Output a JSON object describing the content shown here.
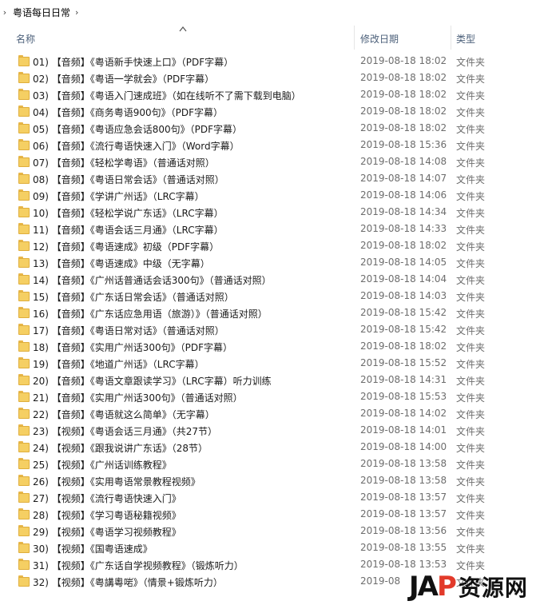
{
  "breadcrumb": {
    "chevron": "›",
    "path": "粤语每日日常",
    "separator": "›"
  },
  "header": {
    "name": "名称",
    "date": "修改日期",
    "type": "类型",
    "sort_icon": "chevron-up-icon"
  },
  "rows": [
    {
      "name": "01) 【音频】《粤语新手快速上口》（PDF字幕）",
      "date": "2019-08-18 18:02",
      "type": "文件夹"
    },
    {
      "name": "02) 【音频】《粤语一学就会》（PDF字幕）",
      "date": "2019-08-18 18:02",
      "type": "文件夹"
    },
    {
      "name": "03) 【音频】《粤语入门速成班》（如在线听不了需下载到电脑）",
      "date": "2019-08-18 18:02",
      "type": "文件夹"
    },
    {
      "name": "04) 【音频】《商务粤语900句》（PDF字幕）",
      "date": "2019-08-18 18:02",
      "type": "文件夹"
    },
    {
      "name": "05) 【音频】《粤语应急会话800句》（PDF字幕）",
      "date": "2019-08-18 18:02",
      "type": "文件夹"
    },
    {
      "name": "06) 【音频】《流行粤语快速入门》（Word字幕）",
      "date": "2019-08-18 15:36",
      "type": "文件夹"
    },
    {
      "name": "07) 【音频】《轻松学粤语》（普通话对照）",
      "date": "2019-08-18 14:08",
      "type": "文件夹"
    },
    {
      "name": "08) 【音频】《粤语日常会话》（普通话对照）",
      "date": "2019-08-18 14:07",
      "type": "文件夹"
    },
    {
      "name": "09) 【音频】《学讲广州话》（LRC字幕）",
      "date": "2019-08-18 14:06",
      "type": "文件夹"
    },
    {
      "name": "10) 【音频】《轻松学说广东话》（LRC字幕）",
      "date": "2019-08-18 14:34",
      "type": "文件夹"
    },
    {
      "name": "11) 【音频】《粤语会话三月通》（LRC字幕）",
      "date": "2019-08-18 14:33",
      "type": "文件夹"
    },
    {
      "name": "12) 【音频】《粤语速成》初级（PDF字幕）",
      "date": "2019-08-18 18:02",
      "type": "文件夹"
    },
    {
      "name": "13) 【音频】《粤语速成》中级（无字幕）",
      "date": "2019-08-18 14:05",
      "type": "文件夹"
    },
    {
      "name": "14) 【音频】《广州话普通话会话300句》（普通话对照）",
      "date": "2019-08-18 14:04",
      "type": "文件夹"
    },
    {
      "name": "15) 【音频】《广东话日常会话》（普通话对照）",
      "date": "2019-08-18 14:03",
      "type": "文件夹"
    },
    {
      "name": "16) 【音频】《广东话应急用语（旅游）》（普通话对照）",
      "date": "2019-08-18 15:42",
      "type": "文件夹"
    },
    {
      "name": "17) 【音频】《粤语日常对话》（普通话对照）",
      "date": "2019-08-18 15:42",
      "type": "文件夹"
    },
    {
      "name": "18) 【音频】《实用广州话300句》（PDF字幕）",
      "date": "2019-08-18 18:02",
      "type": "文件夹"
    },
    {
      "name": "19) 【音频】《地道广州话》（LRC字幕）",
      "date": "2019-08-18 15:52",
      "type": "文件夹"
    },
    {
      "name": "20) 【音频】《粤语文章跟读学习》（LRC字幕）听力训练",
      "date": "2019-08-18 14:31",
      "type": "文件夹"
    },
    {
      "name": "21) 【音频】《实用广州话300句》（普通话对照）",
      "date": "2019-08-18 15:53",
      "type": "文件夹"
    },
    {
      "name": "22) 【音频】《粤语就这么简单》（无字幕）",
      "date": "2019-08-18 14:02",
      "type": "文件夹"
    },
    {
      "name": "23) 【视频】《粤语会话三月通》（共27节）",
      "date": "2019-08-18 14:01",
      "type": "文件夹"
    },
    {
      "name": "24) 【视频】《跟我说讲广东话》（28节）",
      "date": "2019-08-18 14:00",
      "type": "文件夹"
    },
    {
      "name": "25) 【视频】《广州话训练教程》",
      "date": "2019-08-18 13:58",
      "type": "文件夹"
    },
    {
      "name": "26) 【视频】《实用粤语常景教程视频》",
      "date": "2019-08-18 13:58",
      "type": "文件夹"
    },
    {
      "name": "27) 【视频】《流行粤语快速入门》",
      "date": "2019-08-18 13:57",
      "type": "文件夹"
    },
    {
      "name": "28) 【视频】《学习粤语秘籍视频》",
      "date": "2019-08-18 13:57",
      "type": "文件夹"
    },
    {
      "name": "29) 【视频】《粤语学习视频教程》",
      "date": "2019-08-18 13:56",
      "type": "文件夹"
    },
    {
      "name": "30) 【视频】《国粤语速成》",
      "date": "2019-08-18 13:55",
      "type": "文件夹"
    },
    {
      "name": "31) 【视频】《广东话自学视频教程》（锻炼听力）",
      "date": "2019-08-18 13:53",
      "type": "文件夹"
    },
    {
      "name": "32) 【视频】《粤講粵啱》（情景+锻炼听力）",
      "date": "2019-08",
      "type": "文件夹"
    }
  ],
  "watermark": {
    "logo_j": "J",
    "logo_a": "A",
    "logo_p": "P",
    "text": "资源网"
  }
}
